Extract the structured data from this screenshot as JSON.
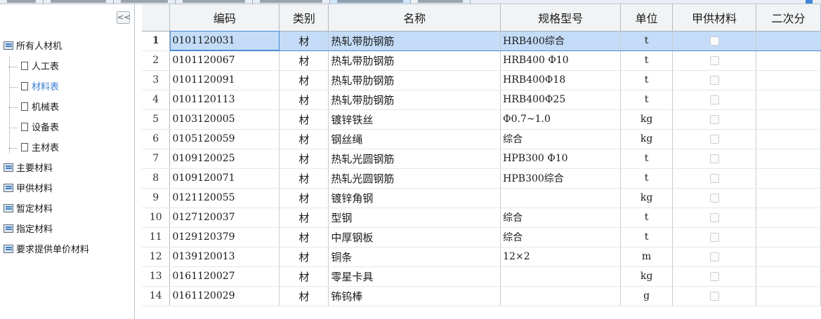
{
  "sidebar": {
    "collapse_label": "<<",
    "items": [
      {
        "label": "所有人材机",
        "level": "root",
        "icon": "folder-icon"
      },
      {
        "label": "人工表",
        "level": "child",
        "icon": "document-icon"
      },
      {
        "label": "材料表",
        "level": "child",
        "icon": "document-icon",
        "selected": true
      },
      {
        "label": "机械表",
        "level": "child",
        "icon": "document-icon"
      },
      {
        "label": "设备表",
        "level": "child",
        "icon": "document-icon"
      },
      {
        "label": "主材表",
        "level": "child",
        "icon": "document-icon"
      },
      {
        "label": "主要材料",
        "level": "root",
        "icon": "folder-icon"
      },
      {
        "label": "甲供材料",
        "level": "root",
        "icon": "folder-icon"
      },
      {
        "label": "暂定材料",
        "level": "root",
        "icon": "folder-icon"
      },
      {
        "label": "指定材料",
        "level": "root",
        "icon": "folder-icon"
      },
      {
        "label": "要求提供单价材料",
        "level": "root",
        "icon": "folder-icon"
      }
    ]
  },
  "grid": {
    "columns": [
      "",
      "编码",
      "类别",
      "名称",
      "规格型号",
      "单位",
      "甲供材料",
      "二次分"
    ],
    "rows": [
      {
        "no": "1",
        "code": "0101120031",
        "cat": "材",
        "name": "热轧带肋钢筋",
        "spec": "HRB400综合",
        "unit": "t",
        "selected": true
      },
      {
        "no": "2",
        "code": "0101120067",
        "cat": "材",
        "name": "热轧带肋钢筋",
        "spec": "HRB400 Φ10",
        "unit": "t"
      },
      {
        "no": "3",
        "code": "0101120091",
        "cat": "材",
        "name": "热轧带肋钢筋",
        "spec": "HRB400Φ18",
        "unit": "t"
      },
      {
        "no": "4",
        "code": "0101120113",
        "cat": "材",
        "name": "热轧带肋钢筋",
        "spec": "HRB400Φ25",
        "unit": "t"
      },
      {
        "no": "5",
        "code": "0103120005",
        "cat": "材",
        "name": "镀锌铁丝",
        "spec": "Φ0.7~1.0",
        "unit": "kg"
      },
      {
        "no": "6",
        "code": "0105120059",
        "cat": "材",
        "name": "钢丝绳",
        "spec": "综合",
        "unit": "kg"
      },
      {
        "no": "7",
        "code": "0109120025",
        "cat": "材",
        "name": "热轧光圆钢筋",
        "spec": "HPB300 Φ10",
        "unit": "t"
      },
      {
        "no": "8",
        "code": "0109120071",
        "cat": "材",
        "name": "热轧光圆钢筋",
        "spec": "HPB300综合",
        "unit": "t"
      },
      {
        "no": "9",
        "code": "0121120055",
        "cat": "材",
        "name": "镀锌角钢",
        "spec": "",
        "unit": "kg"
      },
      {
        "no": "10",
        "code": "0127120037",
        "cat": "材",
        "name": "型钢",
        "spec": "综合",
        "unit": "t"
      },
      {
        "no": "11",
        "code": "0129120379",
        "cat": "材",
        "name": "中厚钢板",
        "spec": "综合",
        "unit": "t"
      },
      {
        "no": "12",
        "code": "0139120013",
        "cat": "材",
        "name": "铜条",
        "spec": "12×2",
        "unit": "m"
      },
      {
        "no": "13",
        "code": "0161120027",
        "cat": "材",
        "name": "零星卡具",
        "spec": "",
        "unit": "kg"
      },
      {
        "no": "14",
        "code": "0161120029",
        "cat": "材",
        "name": "钸钨棒",
        "spec": "",
        "unit": "g"
      }
    ]
  }
}
